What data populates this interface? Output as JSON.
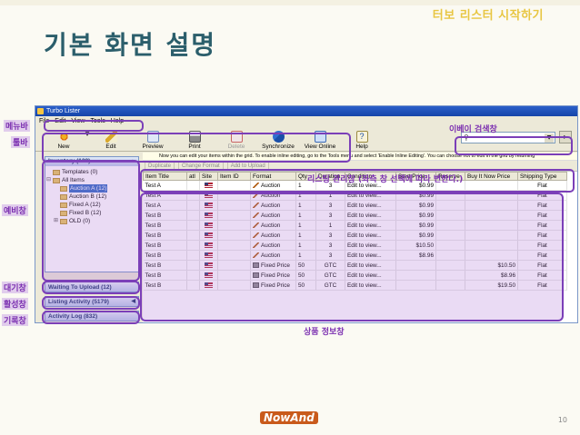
{
  "slide": {
    "subtitle": "터보 리스터 시작하기",
    "title": "기본 화면 설명",
    "page_number": "10",
    "footer_logo": "NowAnd"
  },
  "app": {
    "window_title": "Turbo Lister",
    "menu": [
      "File",
      "Edit",
      "View",
      "Tools",
      "Help"
    ],
    "toolbar": [
      {
        "label": "New",
        "icon": "new-icon",
        "enabled": true
      },
      {
        "label": "Edit",
        "icon": "edit-icon",
        "enabled": true
      },
      {
        "label": "Preview",
        "icon": "preview-icon",
        "enabled": true
      },
      {
        "label": "Print",
        "icon": "print-icon",
        "enabled": true
      },
      {
        "label": "Delete",
        "icon": "delete-icon",
        "enabled": false
      },
      {
        "label": "Synchronize",
        "icon": "synchronize-icon",
        "enabled": true
      },
      {
        "label": "View Online",
        "icon": "view-online-icon",
        "enabled": true
      },
      {
        "label": "Help",
        "icon": "help-icon",
        "enabled": true
      }
    ],
    "inventory": {
      "header": "Inventory (128)",
      "tree": [
        {
          "label": "Templates (0)",
          "level": 1,
          "selected": false
        },
        {
          "label": "All Items",
          "level": 1,
          "selected": false
        },
        {
          "label": "Auction A (12)",
          "level": 2,
          "selected": true
        },
        {
          "label": "Auction B (12)",
          "level": 2,
          "selected": false
        },
        {
          "label": "Fixed A (12)",
          "level": 2,
          "selected": false
        },
        {
          "label": "Fixed B (12)",
          "level": 2,
          "selected": false
        },
        {
          "label": "OLD (0)",
          "level": 2,
          "selected": false
        }
      ]
    },
    "stack_bars": [
      {
        "label": "Waiting To Upload (12)"
      },
      {
        "label": "Listing Activity (5179)"
      },
      {
        "label": "Activity Log (832)"
      }
    ],
    "info_line": "Now you can edit your items within the grid. To enable inline editing, go to the Tools menu and select 'Enable Inline Editing'. You can choose not to edit in the grid by returning",
    "grid_toolbar": [
      "Duplicate",
      "Change Format",
      "Add to Upload"
    ],
    "columns": [
      "Item Title",
      "atl",
      "Site",
      "Item ID",
      "Format",
      "Qty",
      "Duration",
      "Condition",
      "Start Price",
      "Reserve",
      "Buy It Now Price",
      "Shipping Type"
    ],
    "rows": [
      {
        "title": "Test A",
        "format": "Auction",
        "fmt": "auction",
        "qty": "1",
        "duration": "3",
        "condition": "Edit to view...",
        "start": "$0.99",
        "reserve": "",
        "bin": "",
        "ship": "Flat"
      },
      {
        "title": "Test A",
        "format": "Auction",
        "fmt": "auction",
        "qty": "1",
        "duration": "1",
        "condition": "Edit to view...",
        "start": "$0.99",
        "reserve": "",
        "bin": "",
        "ship": "Flat"
      },
      {
        "title": "Test A",
        "format": "Auction",
        "fmt": "auction",
        "qty": "1",
        "duration": "3",
        "condition": "Edit to view...",
        "start": "$0.99",
        "reserve": "",
        "bin": "",
        "ship": "Flat"
      },
      {
        "title": "Test B",
        "format": "Auction",
        "fmt": "auction",
        "qty": "1",
        "duration": "3",
        "condition": "Edit to view...",
        "start": "$0.99",
        "reserve": "",
        "bin": "",
        "ship": "Flat"
      },
      {
        "title": "Test B",
        "format": "Auction",
        "fmt": "auction",
        "qty": "1",
        "duration": "1",
        "condition": "Edit to view...",
        "start": "$0.99",
        "reserve": "",
        "bin": "",
        "ship": "Flat"
      },
      {
        "title": "Test B",
        "format": "Auction",
        "fmt": "auction",
        "qty": "1",
        "duration": "3",
        "condition": "Edit to view...",
        "start": "$0.99",
        "reserve": "",
        "bin": "",
        "ship": "Flat"
      },
      {
        "title": "Test B",
        "format": "Auction",
        "fmt": "auction",
        "qty": "1",
        "duration": "3",
        "condition": "Edit to view...",
        "start": "$10.50",
        "reserve": "",
        "bin": "",
        "ship": "Flat"
      },
      {
        "title": "Test B",
        "format": "Auction",
        "fmt": "auction",
        "qty": "1",
        "duration": "3",
        "condition": "Edit to view...",
        "start": "$8.96",
        "reserve": "",
        "bin": "",
        "ship": "Flat"
      },
      {
        "title": "Test B",
        "format": "Fixed Price",
        "fmt": "fixed",
        "qty": "50",
        "duration": "GTC",
        "condition": "Edit to view...",
        "start": "",
        "reserve": "",
        "bin": "$10.50",
        "ship": "Flat"
      },
      {
        "title": "Test B",
        "format": "Fixed Price",
        "fmt": "fixed",
        "qty": "50",
        "duration": "GTC",
        "condition": "Edit to view...",
        "start": "",
        "reserve": "",
        "bin": "$8.96",
        "ship": "Flat"
      },
      {
        "title": "Test B",
        "format": "Fixed Price",
        "fmt": "fixed",
        "qty": "50",
        "duration": "GTC",
        "condition": "Edit to view...",
        "start": "",
        "reserve": "",
        "bin": "$19.50",
        "ship": "Flat"
      }
    ]
  },
  "callouts": {
    "menubar": "메뉴바",
    "toolbar": "툴바",
    "prep": "예비창",
    "waiting": "대기창",
    "activity": "활성창",
    "log": "기록창",
    "ebay_search": "이베이 검색창",
    "listing_mgmt": "리스팅 관리창 (좌측 창 선택에 따라 변한다.)",
    "product_info": "상품 정보창"
  },
  "colors": {
    "annotation": "#7b3fb8",
    "title": "#2b5e6b",
    "subtitle": "#e8c642"
  }
}
